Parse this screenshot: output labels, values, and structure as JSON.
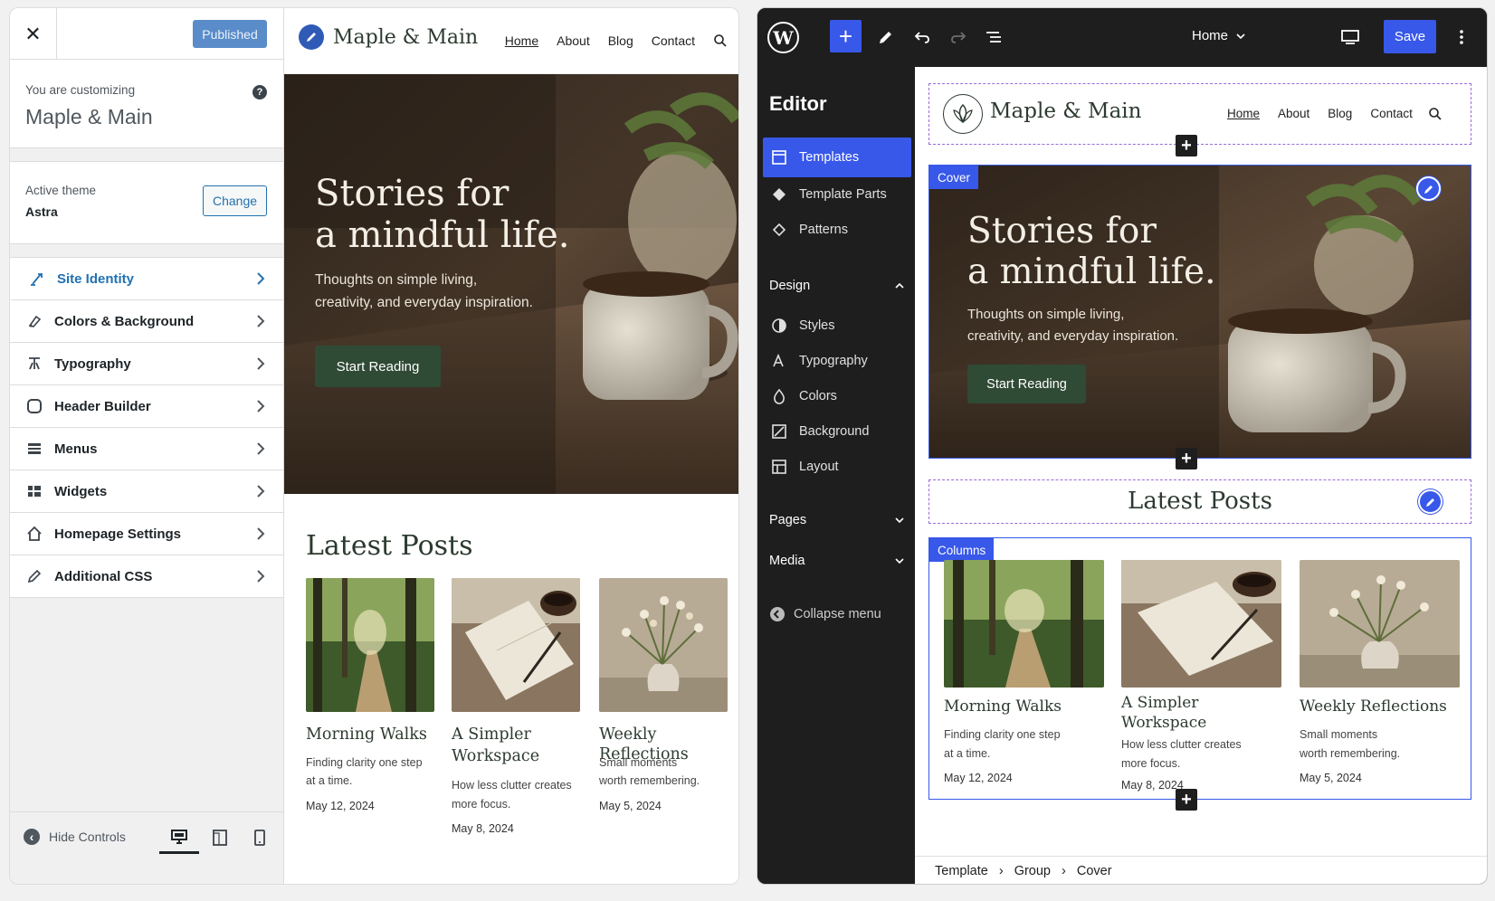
{
  "customizer": {
    "status_button": "Published",
    "close_label": "✕",
    "info_small": "You are customizing",
    "info_site": "Maple & Main",
    "help": "?",
    "theme_label": "Active theme",
    "theme_name": "Astra",
    "change_button": "Change",
    "menu": [
      {
        "label": "Site Identity",
        "icon": "brush-icon"
      },
      {
        "label": "Colors & Background",
        "icon": "palette-icon"
      },
      {
        "label": "Typography",
        "icon": "typography-icon"
      },
      {
        "label": "Header Builder",
        "icon": "header-icon"
      },
      {
        "label": "Menus",
        "icon": "menu-icon"
      },
      {
        "label": "Widgets",
        "icon": "widgets-icon"
      },
      {
        "label": "Homepage Settings",
        "icon": "home-icon"
      },
      {
        "label": "Additional CSS",
        "icon": "pencil-icon"
      }
    ],
    "hide_controls": "Hide Controls"
  },
  "preview": {
    "site_name": "Maple & Main",
    "nav": [
      "Home",
      "About",
      "Blog",
      "Contact"
    ],
    "hero_title_1": "Stories for",
    "hero_title_2": "a mindful life.",
    "hero_text_1": "Thoughts on simple living,",
    "hero_text_2": "creativity, and everyday inspiration.",
    "hero_button": "Start Reading",
    "latest_title": "Latest Posts",
    "posts": [
      {
        "title_1": "Morning Walks",
        "title_2": "",
        "desc_1": "Finding clarity one step",
        "desc_2": "at a time.",
        "date": "May 12, 2024"
      },
      {
        "title_1": "A Simpler",
        "title_2": "Workspace",
        "desc_1": "How less clutter creates",
        "desc_2": "more focus.",
        "date": "May 8, 2024"
      },
      {
        "title_1": "Weekly Reflections",
        "title_2": "",
        "desc_1": "Small moments",
        "desc_2": "worth remembering.",
        "date": "May 5, 2024"
      }
    ]
  },
  "editor": {
    "template_name": "Home",
    "save_button": "Save",
    "sidebar_title": "Editor",
    "items": [
      "Templates",
      "Template Parts",
      "Patterns"
    ],
    "design_label": "Design",
    "design_items": [
      "Styles",
      "Typography",
      "Colors",
      "Background",
      "Layout"
    ],
    "pages_label": "Pages",
    "media_label": "Media",
    "collapse_label": "Collapse menu",
    "cover_tag": "Cover",
    "columns_tag": "Columns",
    "breadcrumbs": [
      "Template",
      "Group",
      "Cover"
    ]
  },
  "colors": {
    "wp_blue": "#3858e9",
    "admin_blue": "#2271b1",
    "forest": "#2f4a35"
  }
}
